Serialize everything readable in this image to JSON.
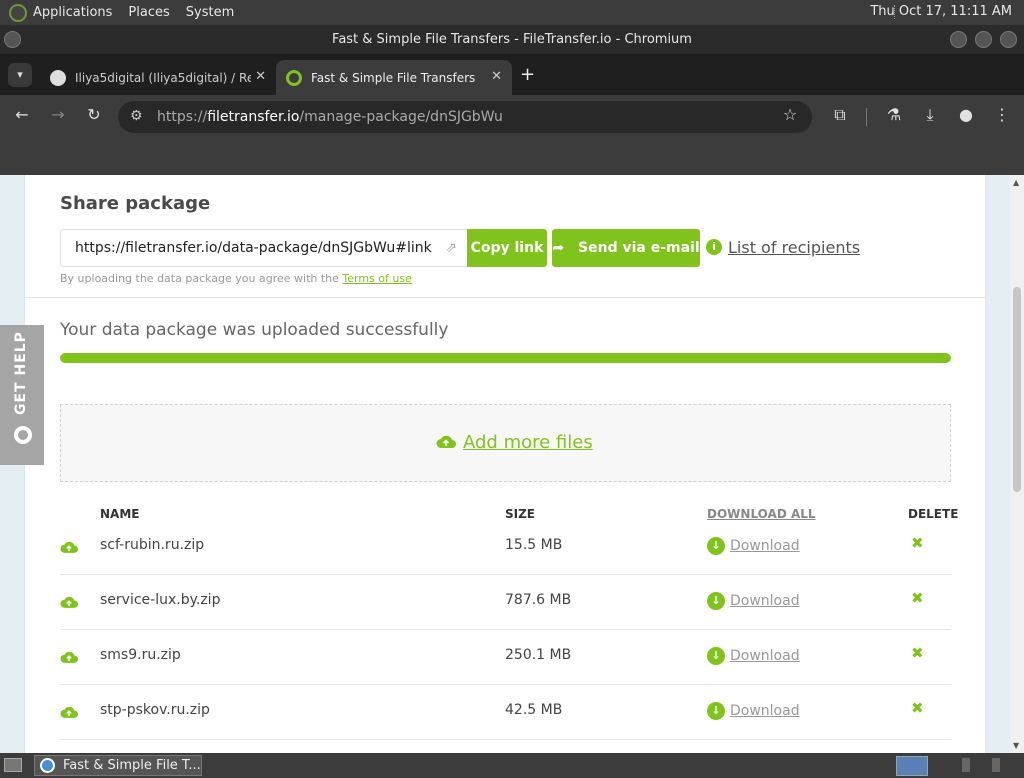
{
  "os_panel": {
    "menus": [
      "Applications",
      "Places",
      "System"
    ],
    "clock": "Thu Oct 17, 11:11 AM"
  },
  "window": {
    "title": "Fast & Simple File Transfers - FileTransfer.io - Chromium"
  },
  "browser": {
    "tabs": [
      {
        "label": "Iliya5digital (Iliya5digital) / Re",
        "active": false
      },
      {
        "label": "Fast & Simple File Transfers",
        "active": true
      }
    ],
    "url_prefix": "https://",
    "url_host": "filetransfer.io",
    "url_path": "/manage-package/dnSJGbWu"
  },
  "share": {
    "title": "Share package",
    "link": "https://filetransfer.io/data-package/dnSJGbWu#link",
    "copy_label": "Copy link",
    "send_label": "Send via e-mail",
    "recipients_label": "List of recipients",
    "terms_prefix": "By uploading the data package you agree with the",
    "terms_link": "Terms of use"
  },
  "upload": {
    "status": "Your data package was uploaded successfully",
    "progress": 1.0,
    "add_more_label": "Add more files"
  },
  "table": {
    "headers": {
      "name": "NAME",
      "size": "SIZE",
      "download_all": "DOWNLOAD ALL",
      "delete": "DELETE"
    },
    "rows": [
      {
        "name": "scf-rubin.ru.zip",
        "size": "15.5 MB",
        "download": "Download"
      },
      {
        "name": "service-lux.by.zip",
        "size": "787.6 MB",
        "download": "Download"
      },
      {
        "name": "sms9.ru.zip",
        "size": "250.1 MB",
        "download": "Download"
      },
      {
        "name": "stp-pskov.ru.zip",
        "size": "42.5 MB",
        "download": "Download"
      }
    ]
  },
  "help": {
    "label": "GET HELP"
  },
  "taskbar": {
    "item_label": "Fast & Simple File T..."
  },
  "colors": {
    "accent": "#80c31c",
    "panel": "#3c3c3c"
  }
}
